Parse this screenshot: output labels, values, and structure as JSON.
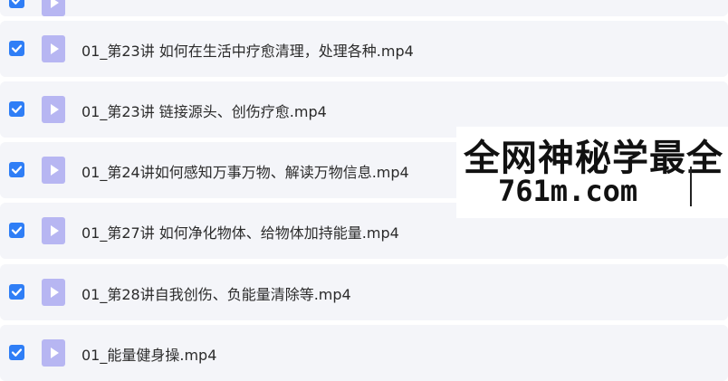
{
  "files": [
    {
      "name": "",
      "checked": true
    },
    {
      "name": "01_第23讲 如何在生活中疗愈清理，处理各种.mp4",
      "checked": true
    },
    {
      "name": "01_第23讲 链接源头、创伤疗愈.mp4",
      "checked": true
    },
    {
      "name": "01_第24讲如何感知万事万物、解读万物信息.mp4",
      "checked": true
    },
    {
      "name": "01_第27讲 如何净化物体、给物体加持能量.mp4",
      "checked": true
    },
    {
      "name": "01_第28讲自我创伤、负能量清除等.mp4",
      "checked": true
    },
    {
      "name": "01_能量健身操.mp4",
      "checked": true
    }
  ],
  "watermark": {
    "line1": "全网神秘学最全",
    "line2": "761m.com"
  },
  "colors": {
    "checkbox": "#2f7ef6",
    "file_icon": "#b7b6f2",
    "row_bg": "#f4f5f9"
  }
}
